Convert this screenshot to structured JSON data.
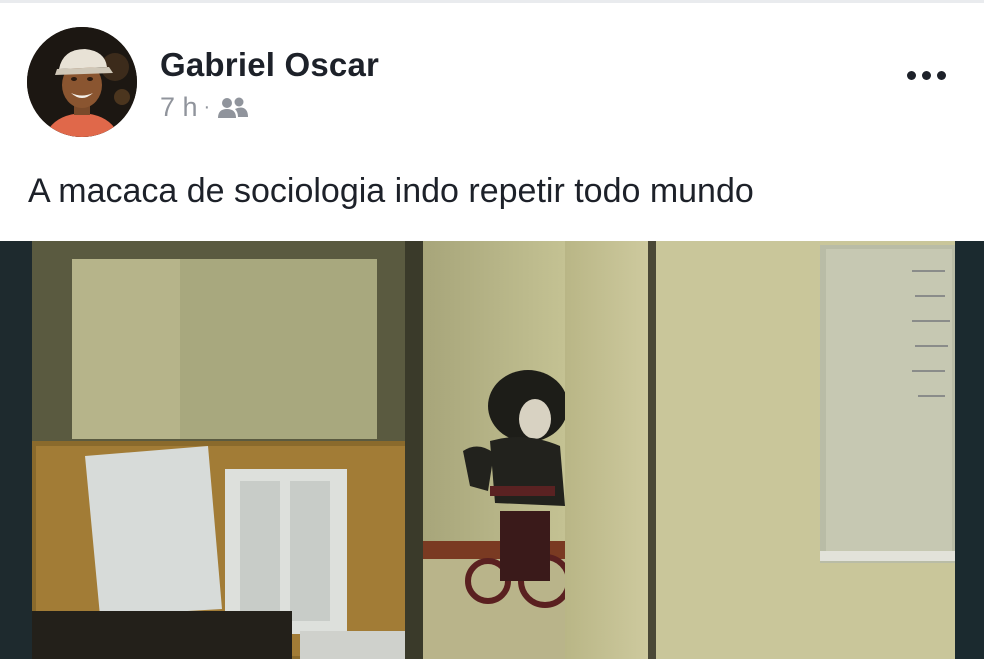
{
  "post": {
    "author": "Gabriel Oscar",
    "time": "7 h",
    "separator": "·",
    "audience_icon": "friends-icon",
    "menu_icon": "more-options-icon",
    "text": "A macaca de sociologia indo repetir todo mundo"
  },
  "colors": {
    "name": "#1d2129",
    "meta": "#90949c",
    "background": "#ffffff"
  }
}
